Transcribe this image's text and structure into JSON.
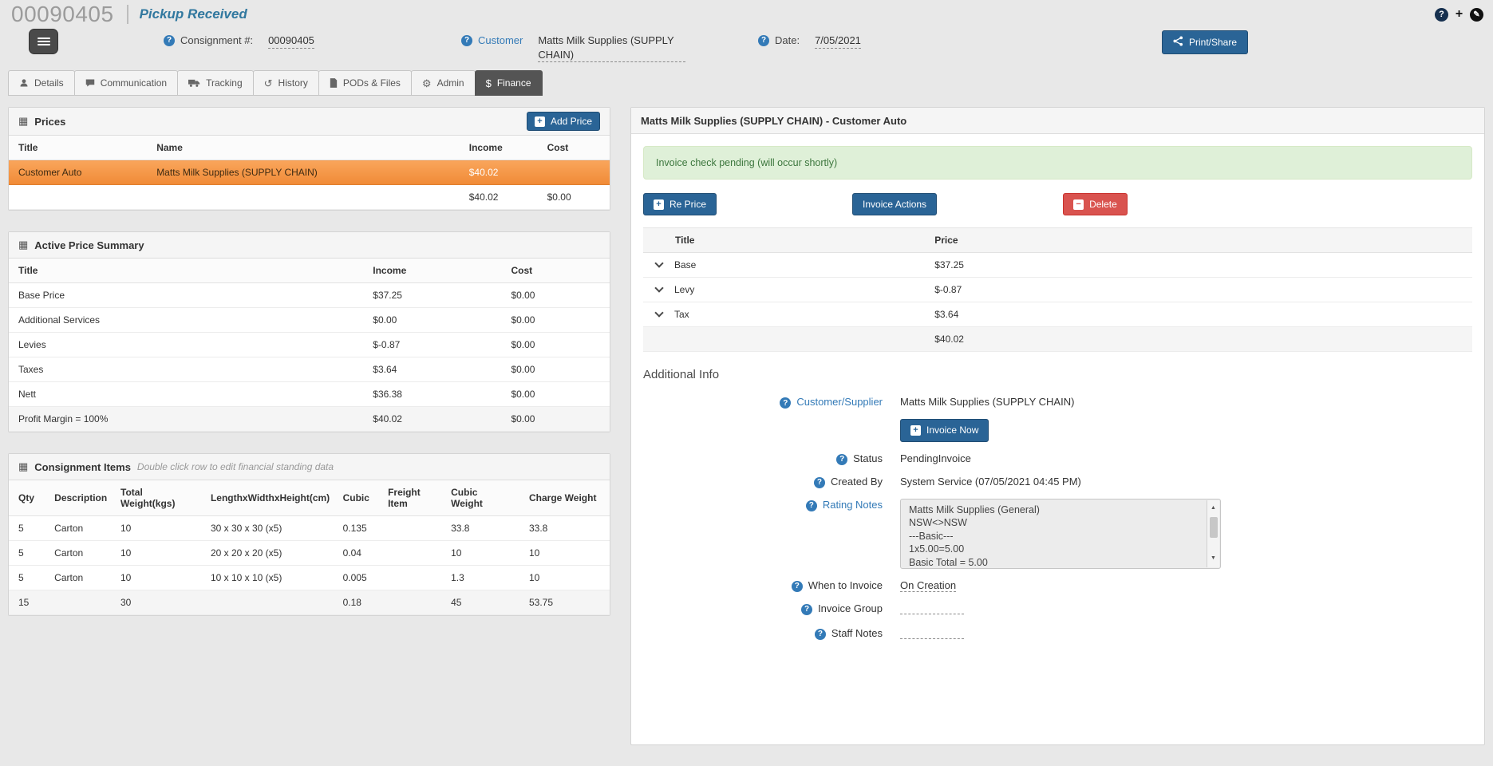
{
  "icons": {
    "help_glyph": "?",
    "add_glyph": "+",
    "edit_glyph": "✎",
    "panel_glyph": "▦",
    "plus_glyph": "+",
    "minus_glyph": "−",
    "dollar_glyph": "$",
    "history_glyph": "↺",
    "gear_glyph": "⚙",
    "scroll_up_glyph": "▲",
    "scroll_down_glyph": "▼"
  },
  "header": {
    "consignment_number": "00090405",
    "status_text": "Pickup Received"
  },
  "toolbar": {
    "consignment_label": "Consignment #:",
    "consignment_value": "00090405",
    "customer_label": "Customer",
    "customer_value": "Matts Milk Supplies (SUPPLY CHAIN)",
    "date_label": "Date:",
    "date_value": "7/05/2021",
    "print_share_label": "Print/Share"
  },
  "tabs": [
    {
      "label": "Details",
      "icon": "user"
    },
    {
      "label": "Communication",
      "icon": "comment"
    },
    {
      "label": "Tracking",
      "icon": "truck"
    },
    {
      "label": "History",
      "icon": "history"
    },
    {
      "label": "PODs & Files",
      "icon": "file"
    },
    {
      "label": "Admin",
      "icon": "gear"
    },
    {
      "label": "Finance",
      "icon": "dollar",
      "active": true
    }
  ],
  "prices_panel": {
    "title": "Prices",
    "add_button_label": "Add Price",
    "headers": {
      "title": "Title",
      "name": "Name",
      "income": "Income",
      "cost": "Cost"
    },
    "row": {
      "title": "Customer Auto",
      "name": "Matts Milk Supplies (SUPPLY CHAIN)",
      "income": "$40.02",
      "cost": ""
    },
    "total": {
      "income": "$40.02",
      "cost": "$0.00"
    }
  },
  "price_summary_panel": {
    "title": "Active Price Summary",
    "headers": {
      "title": "Title",
      "income": "Income",
      "cost": "Cost"
    },
    "rows": [
      {
        "title": "Base Price",
        "income": "$37.25",
        "cost": "$0.00"
      },
      {
        "title": "Additional Services",
        "income": "$0.00",
        "cost": "$0.00"
      },
      {
        "title": "Levies",
        "income": "$-0.87",
        "cost": "$0.00"
      },
      {
        "title": "Taxes",
        "income": "$3.64",
        "cost": "$0.00"
      },
      {
        "title": "Nett",
        "income": "$36.38",
        "cost": "$0.00"
      },
      {
        "title": "Profit Margin = 100%",
        "income": "$40.02",
        "cost": "$0.00"
      }
    ]
  },
  "items_panel": {
    "title": "Consignment Items",
    "subtitle": "Double click row to edit financial standing data",
    "headers": [
      "Qty",
      "Description",
      "Total Weight(kgs)",
      "LengthxWidthxHeight(cm)",
      "Cubic",
      "Freight Item",
      "Cubic Weight",
      "Charge Weight"
    ],
    "rows": [
      [
        "5",
        "Carton",
        "10",
        "30 x 30 x 30 (x5)",
        "0.135",
        "",
        "33.8",
        "33.8"
      ],
      [
        "5",
        "Carton",
        "10",
        "20 x 20 x 20 (x5)",
        "0.04",
        "",
        "10",
        "10"
      ],
      [
        "5",
        "Carton",
        "10",
        "10 x 10 x 10 (x5)",
        "0.005",
        "",
        "1.3",
        "10"
      ]
    ],
    "totals": [
      "15",
      "",
      "30",
      "",
      "0.18",
      "",
      "45",
      "53.75"
    ]
  },
  "invoice_panel": {
    "title": "Matts Milk Supplies (SUPPLY CHAIN) - Customer Auto",
    "alert_text": "Invoice check pending (will occur shortly)",
    "buttons": {
      "re_price": "Re Price",
      "invoice_actions": "Invoice Actions",
      "delete": "Delete"
    },
    "price_table": {
      "headers": {
        "title": "Title",
        "price": "Price"
      },
      "rows": [
        {
          "title": "Base",
          "price": "$37.25"
        },
        {
          "title": "Levy",
          "price": "$-0.87"
        },
        {
          "title": "Tax",
          "price": "$3.64"
        }
      ],
      "total": "$40.02"
    },
    "additional_info": {
      "heading": "Additional Info",
      "customer_supplier_label": "Customer/Supplier",
      "customer_supplier_value": "Matts Milk Supplies (SUPPLY CHAIN)",
      "invoice_now_label": "Invoice Now",
      "status_label": "Status",
      "status_value": "PendingInvoice",
      "created_by_label": "Created By",
      "created_by_value": "System Service (07/05/2021 04:45 PM)",
      "rating_notes_label": "Rating Notes",
      "rating_notes": "Matts Milk Supplies (General)\nNSW<>NSW\n---Basic---\n1x5.00=5.00\nBasic Total = 5.00",
      "when_to_invoice_label": "When to Invoice",
      "when_to_invoice_value": "On Creation",
      "invoice_group_label": "Invoice Group",
      "staff_notes_label": "Staff Notes"
    }
  }
}
